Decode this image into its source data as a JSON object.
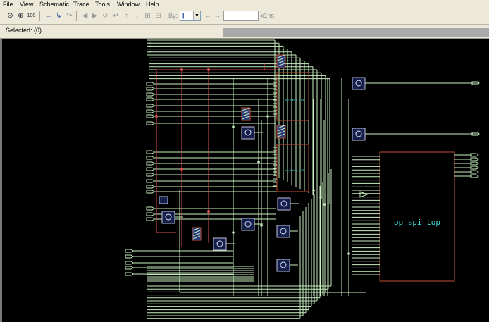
{
  "menu": [
    "File",
    "View",
    "Schematic",
    "Trace",
    "Tools",
    "Window",
    "Help"
  ],
  "toolbar": {
    "zoom_in_icon": "magnifier-plus-icon",
    "zoom_out_icon": "magnifier-minus-icon",
    "zoom_100_label": "100",
    "by_label": "By:",
    "cursor_value": "",
    "unit_label": "x1ns"
  },
  "status": {
    "selected": "Selected: (0)"
  },
  "schematic": {
    "top_module": "op_spi_top",
    "block_labels": [
      "op_Pmtx_d13",
      "op_Pmtx_d13"
    ]
  },
  "colors": {
    "wire": "#c8f0c0",
    "wire_red": "#e05050",
    "box": "#c05030",
    "gate_fill": "#2a3a7a",
    "text": "#40e0e0"
  }
}
